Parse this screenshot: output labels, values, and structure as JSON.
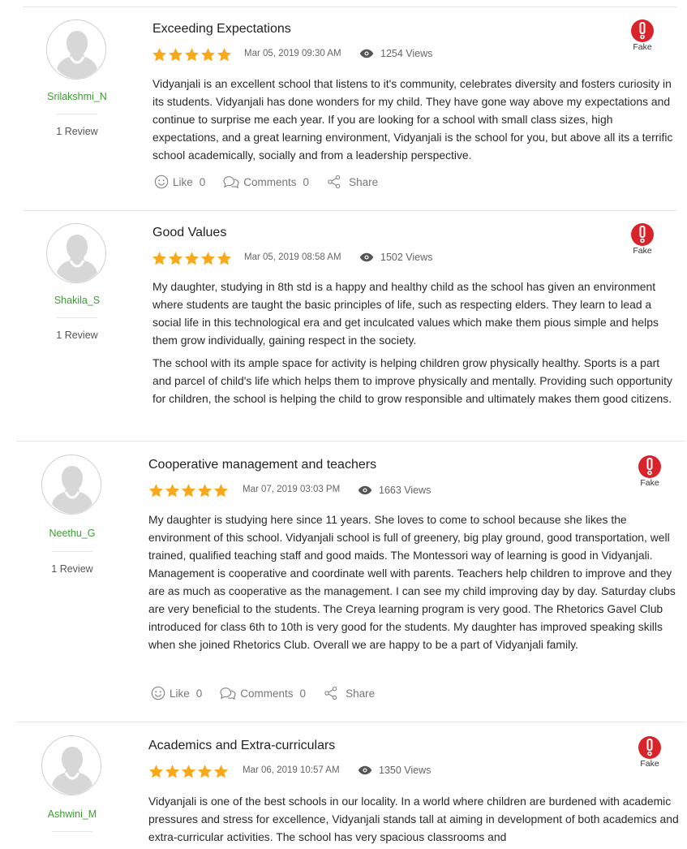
{
  "colors": {
    "star": "#f7a81b",
    "username": "#3d9b33",
    "fake": "#d8232a"
  },
  "icons": {
    "views": "eye-icon",
    "like": "smiley-icon",
    "comments": "comments-icon",
    "share": "share-icon",
    "fake": "exclamation-icon"
  },
  "reviews": [
    {
      "username": "Srilakshmi_N",
      "review_count": "1 Review",
      "title": "Exceeding Expectations",
      "rating": 5,
      "date": "Mar 05, 2019 09:30 AM",
      "views": "1254 Views",
      "fake_label": "Fake",
      "paragraphs": [
        "Vidyanjali is an excellent school that listens to it's community, celebrates diversity and fosters curiosity in its students. Vidyanjali has done wonders for my child. They have gone way above my expectations and continue to surprise me each year. If you are looking for a school with small class sizes, high expectations, and a great learning environment, Vidyanjali is the school for you, but above all its a terrific school academically, socially and from a leadership perspective."
      ],
      "actions": {
        "like": "Like",
        "like_count": "0",
        "comments": "Comments",
        "comments_count": "0",
        "share": "Share"
      }
    },
    {
      "username": "Shakila_S",
      "review_count": "1 Review",
      "title": "Good Values",
      "rating": 5,
      "date": "Mar 05, 2019 08:58 AM",
      "views": "1502 Views",
      "fake_label": "Fake",
      "paragraphs": [
        "My daughter, studying in 8th std is a happy and healthy child as the school has given an environment where students are taught the basic principles of life, such as respecting elders. They learn to lead a social life in this technological era and get inculcated values which make them pious simple and helps them grow individually, gaining respect in the society.",
        "The school with its ample space for activity is helping children grow physically healthy. Sports is a part and parcel of child's life which helps them to improve physically and mentally. Providing such opportunity for children, the school is helping the child to grow responsible and ultimately makes them good citizens."
      ]
    },
    {
      "username": "Neethu_G",
      "review_count": "1 Review",
      "title": "Cooperative management and teachers",
      "rating": 5,
      "date": "Mar 07, 2019 03:03 PM",
      "views": "1663 Views",
      "fake_label": "Fake",
      "paragraphs": [
        "My daughter is studying here since 11 years. She loves to come to school because she likes the environment of this school. Vidyanjali school is full of greenery, big play ground, good transportation, well trained, qualified teaching staff and good maids. The Montessori way of learning is good in Vidyanjali. Management is cooperative and coordinate well with parents. Teachers help children to improve and they are as much as cooperative as the management. I can see my child improving day by day. Saturday clubs are very beneficial to the students. The Creya learning program is very good. The Rhetorics Gavel Club introduced for class 6th to 10th is very good for the students. My daughter has improved speaking skills when she joined Rhetorics Club. Overall we are happy to be a part of Vidyanjali family."
      ],
      "actions": {
        "like": "Like",
        "like_count": "0",
        "comments": "Comments",
        "comments_count": "0",
        "share": "Share"
      }
    },
    {
      "username": "Ashwini_M",
      "title": "Academics and Extra-curriculars",
      "rating": 5,
      "date": "Mar 06, 2019 10:57 AM",
      "views": "1350 Views",
      "fake_label": "Fake",
      "paragraphs": [
        "Vidyanjali is one of the best schools in our locality. In a world where children are burdened with academic pressures and stress for excellence, Vidyanjali stands tall at aiming in development of both academics and extra-curricular activities. The school has very spacious classrooms and"
      ]
    }
  ]
}
